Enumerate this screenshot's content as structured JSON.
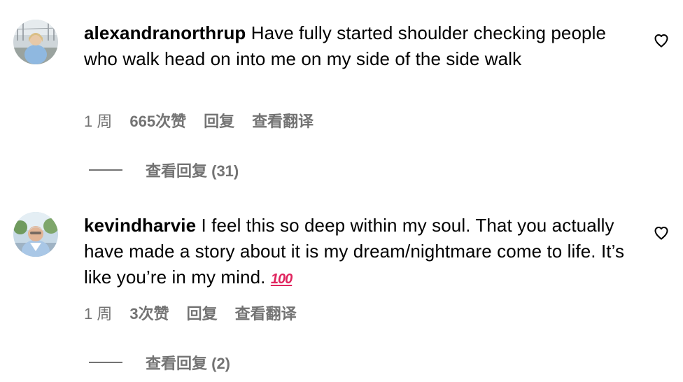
{
  "comments": [
    {
      "avatar_icon": "user-avatar-photo",
      "username": "alexandranorthrup",
      "text": " Have fully started shoulder checking people who walk head on into me on my side of the side walk",
      "time": "1 周",
      "likes": "665次赞",
      "reply_label": "回复",
      "translate_label": "查看翻译",
      "view_replies_label": "查看回复 (31)",
      "like_icon": "heart-outline-icon"
    },
    {
      "avatar_icon": "user-avatar-photo",
      "username": "kevindharvie",
      "text": " I feel this so deep within my soul. That you actually have made a story about it is my dream/nightmare come to life. It’s like you’re in my mind. ",
      "emoji": "100",
      "time": "1 周",
      "likes": "3次赞",
      "reply_label": "回复",
      "translate_label": "查看翻译",
      "view_replies_label": "查看回复 (2)",
      "like_icon": "heart-outline-icon"
    }
  ],
  "colors": {
    "text": "#000000",
    "secondary": "#737373",
    "emoji_red": "#e0245e"
  }
}
